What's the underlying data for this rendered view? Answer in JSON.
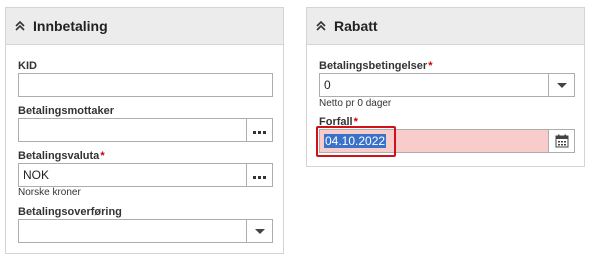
{
  "left_panel": {
    "title": "Innbetaling",
    "fields": {
      "kid": {
        "label": "KID",
        "value": ""
      },
      "mottaker": {
        "label": "Betalingsmottaker",
        "value": ""
      },
      "valuta": {
        "label": "Betalingsvaluta",
        "required_mark": "*",
        "value": "NOK",
        "helper": "Norske kroner"
      },
      "overforing": {
        "label": "Betalingsoverføring",
        "value": ""
      }
    }
  },
  "right_panel": {
    "title": "Rabatt",
    "fields": {
      "betingelser": {
        "label": "Betalingsbetingelser",
        "required_mark": "*",
        "value": "0",
        "helper": "Netto pr 0 dager"
      },
      "forfall": {
        "label": "Forfall",
        "required_mark": "*",
        "value": "04.10.2022"
      }
    }
  },
  "colors": {
    "header_bg": "#ececec",
    "required": "#cc0000",
    "error_bg": "#f9cccc",
    "selection": "#3a72c9",
    "focus_ring": "#d0101a"
  },
  "icons": [
    "chevron-up-double-icon",
    "ellipsis-icon",
    "chevron-down-icon",
    "calendar-icon"
  ]
}
